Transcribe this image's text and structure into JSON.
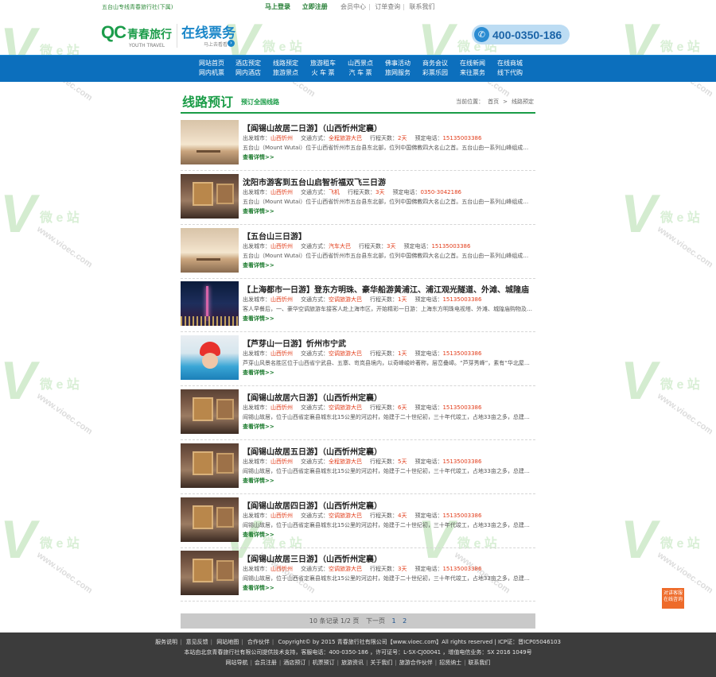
{
  "topbar": {
    "site_name": "五台山专线青春旅行社(下属)",
    "login": "马上登录",
    "register": "立即注册",
    "links": [
      "会员中心",
      "订单查询",
      "联系我们"
    ]
  },
  "header": {
    "logo_qc": "QC",
    "logo_cn": "青春旅行",
    "logo_en": "YOUTH TRAVEL",
    "service_title": "在线票务",
    "service_sub": "马上去看看",
    "hotline": "400-0350-186"
  },
  "nav": {
    "top": [
      "网站首页",
      "酒店预定",
      "线路预定",
      "旅游租车",
      "山西景点",
      "佛事活动",
      "商务会议",
      "在线新闻",
      "在线商城"
    ],
    "bottom": [
      "网内机票",
      "网内酒店",
      "旅游景点",
      "火 车 票",
      "汽 车 票",
      "旅网服务",
      "彩票乐园",
      "来往票务",
      "线下代购"
    ]
  },
  "section": {
    "title": "线路预订",
    "subtitle": "预订全国线路",
    "crumb_label": "当前位置：",
    "crumb_home": "首页",
    "crumb_sep": ">",
    "crumb_current": "线路预定"
  },
  "labels": {
    "city": "出发城市：",
    "transport": "交通方式：",
    "days": "行程天数：",
    "phone": "预定电话：",
    "more": "查看详情>>"
  },
  "routes": [
    {
      "title": "【阎锡山故居二日游】（山西忻州定襄）",
      "city": "山西忻州",
      "transport": "全程旅游大巴",
      "days": "2天",
      "phone": "15135003386",
      "desc": "五台山（Mount Wutai）位于山西省忻州市五台县东北部，位列中国佛教四大名山之首。五台山由一系列山峰组成，素有清凉胜境之称"
    },
    {
      "title": "沈阳市游客到五台山启智祈福双飞三日游",
      "city": "山西忻州",
      "transport": "飞机",
      "days": "3天",
      "phone": "0350-3042186",
      "desc": "五台山（Mount Wutai）位于山西省忻州市五台县东北部，位列中国佛教四大名山之首。五台山由一系列山峰组成，素有清凉胜境之称"
    },
    {
      "title": "【五台山三日游】",
      "city": "山西忻州",
      "transport": "汽车大巴",
      "days": "3天",
      "phone": "15135003386",
      "desc": "五台山（Mount Wutai）位于山西省忻州市五台县东北部，位列中国佛教四大名山之首。五台山由一系列山峰组成，素有清凉胜境之称"
    },
    {
      "title": "【上海都市一日游】登东方明珠、豪华船游黄浦江、浦江观光隧道、外滩、城隍庙",
      "city": "山西忻州",
      "transport": "空调旅游大巴",
      "days": "1天",
      "phone": "15135003386",
      "desc": "客人早餐后，一、豪华空调旅游车接客人赴上海市区，开始精彩一日游：上海东方明珠电视塔、外滩、城隍庙购物及豫园商城等"
    },
    {
      "title": "【芦芽山一日游】忻州市宁武",
      "city": "山西忻州",
      "transport": "空调旅游大巴",
      "days": "1天",
      "phone": "15135003386",
      "desc": "芦芽山风景名胜区位于山西省宁武县、五寨、岢岚县境内，以奇峰峻岭著称，层峦叠嶂。“芦芽秀峰”，素有“华北屋脊”之称"
    },
    {
      "title": "【阎锡山故居六日游】（山西忻州定襄）",
      "city": "山西忻州",
      "transport": "空调旅游大巴",
      "days": "6天",
      "phone": "15135003386",
      "desc": "阎锡山故居，位于山西省定襄县城东北15公里的河边村，始建于二十世纪初，三十年代竣工，占地33亩之多，总建筑面积1.6万平方米"
    },
    {
      "title": "【阎锡山故居五日游】（山西忻州定襄）",
      "city": "山西忻州",
      "transport": "全程旅游大巴",
      "days": "5天",
      "phone": "15135003386",
      "desc": "阎锡山故居，位于山西省定襄县城东北15公里的河边村，始建于二十世纪初，三十年代竣工，占地33亩之多，总建筑面积1.6万平方米"
    },
    {
      "title": "【阎锡山故居四日游】（山西忻州定襄）",
      "city": "山西忻州",
      "transport": "空调旅游大巴",
      "days": "4天",
      "phone": "15135003386",
      "desc": "阎锡山故居，位于山西省定襄县城东北15公里的河边村，始建于二十世纪初，三十年代竣工，占地33亩之多，总建筑面积1.6万平方米"
    },
    {
      "title": "【阎锡山故居三日游】（山西忻州定襄）",
      "city": "山西忻州",
      "transport": "空调旅游大巴",
      "days": "3天",
      "phone": "15135003386",
      "desc": "阎锡山故居，位于山西省定襄县城东北15公里的河边村，始建于二十世纪初，三十年代竣工，占地33亩之多，总建筑面积1.6万平方米"
    }
  ],
  "pager": {
    "summary": "10 条记录 1/2 页",
    "next": "下一页",
    "pages": [
      "1",
      "2"
    ]
  },
  "float_button": {
    "line1": "对讲客服",
    "line2": "在线咨询"
  },
  "footer": {
    "links1": [
      "服务说明",
      "意见反馈",
      "网站地图",
      "合作伙伴"
    ],
    "copyright": "Copyright© by 2015 青春旅行社有限公司【www.vioec.com】All rights reserved | ICP证：晋ICP05046103",
    "line2": "本站由北京青春旅行社有限公司提供技术支持，客服电话：400-0350-186 ，许可证号：L-SX-CJ00041 ，增值电信业务：SX 2016 1049号",
    "links2": [
      "网站导航",
      "会员注册",
      "酒店预订",
      "机票预订",
      "旅游资讯",
      "关于我们",
      "旅游合作伙伴",
      "招贤纳士",
      "联系我们"
    ]
  },
  "watermark": {
    "mark": "V",
    "text": "微 e 站",
    "url": "www.vioec.com"
  },
  "icons": {
    "phone": "phone-icon"
  },
  "colors": {
    "nav_bg": "#0c6fbd",
    "accent_green": "#1a9c47",
    "price_red": "#e23b18",
    "footer_bg": "#3c3c3c"
  }
}
